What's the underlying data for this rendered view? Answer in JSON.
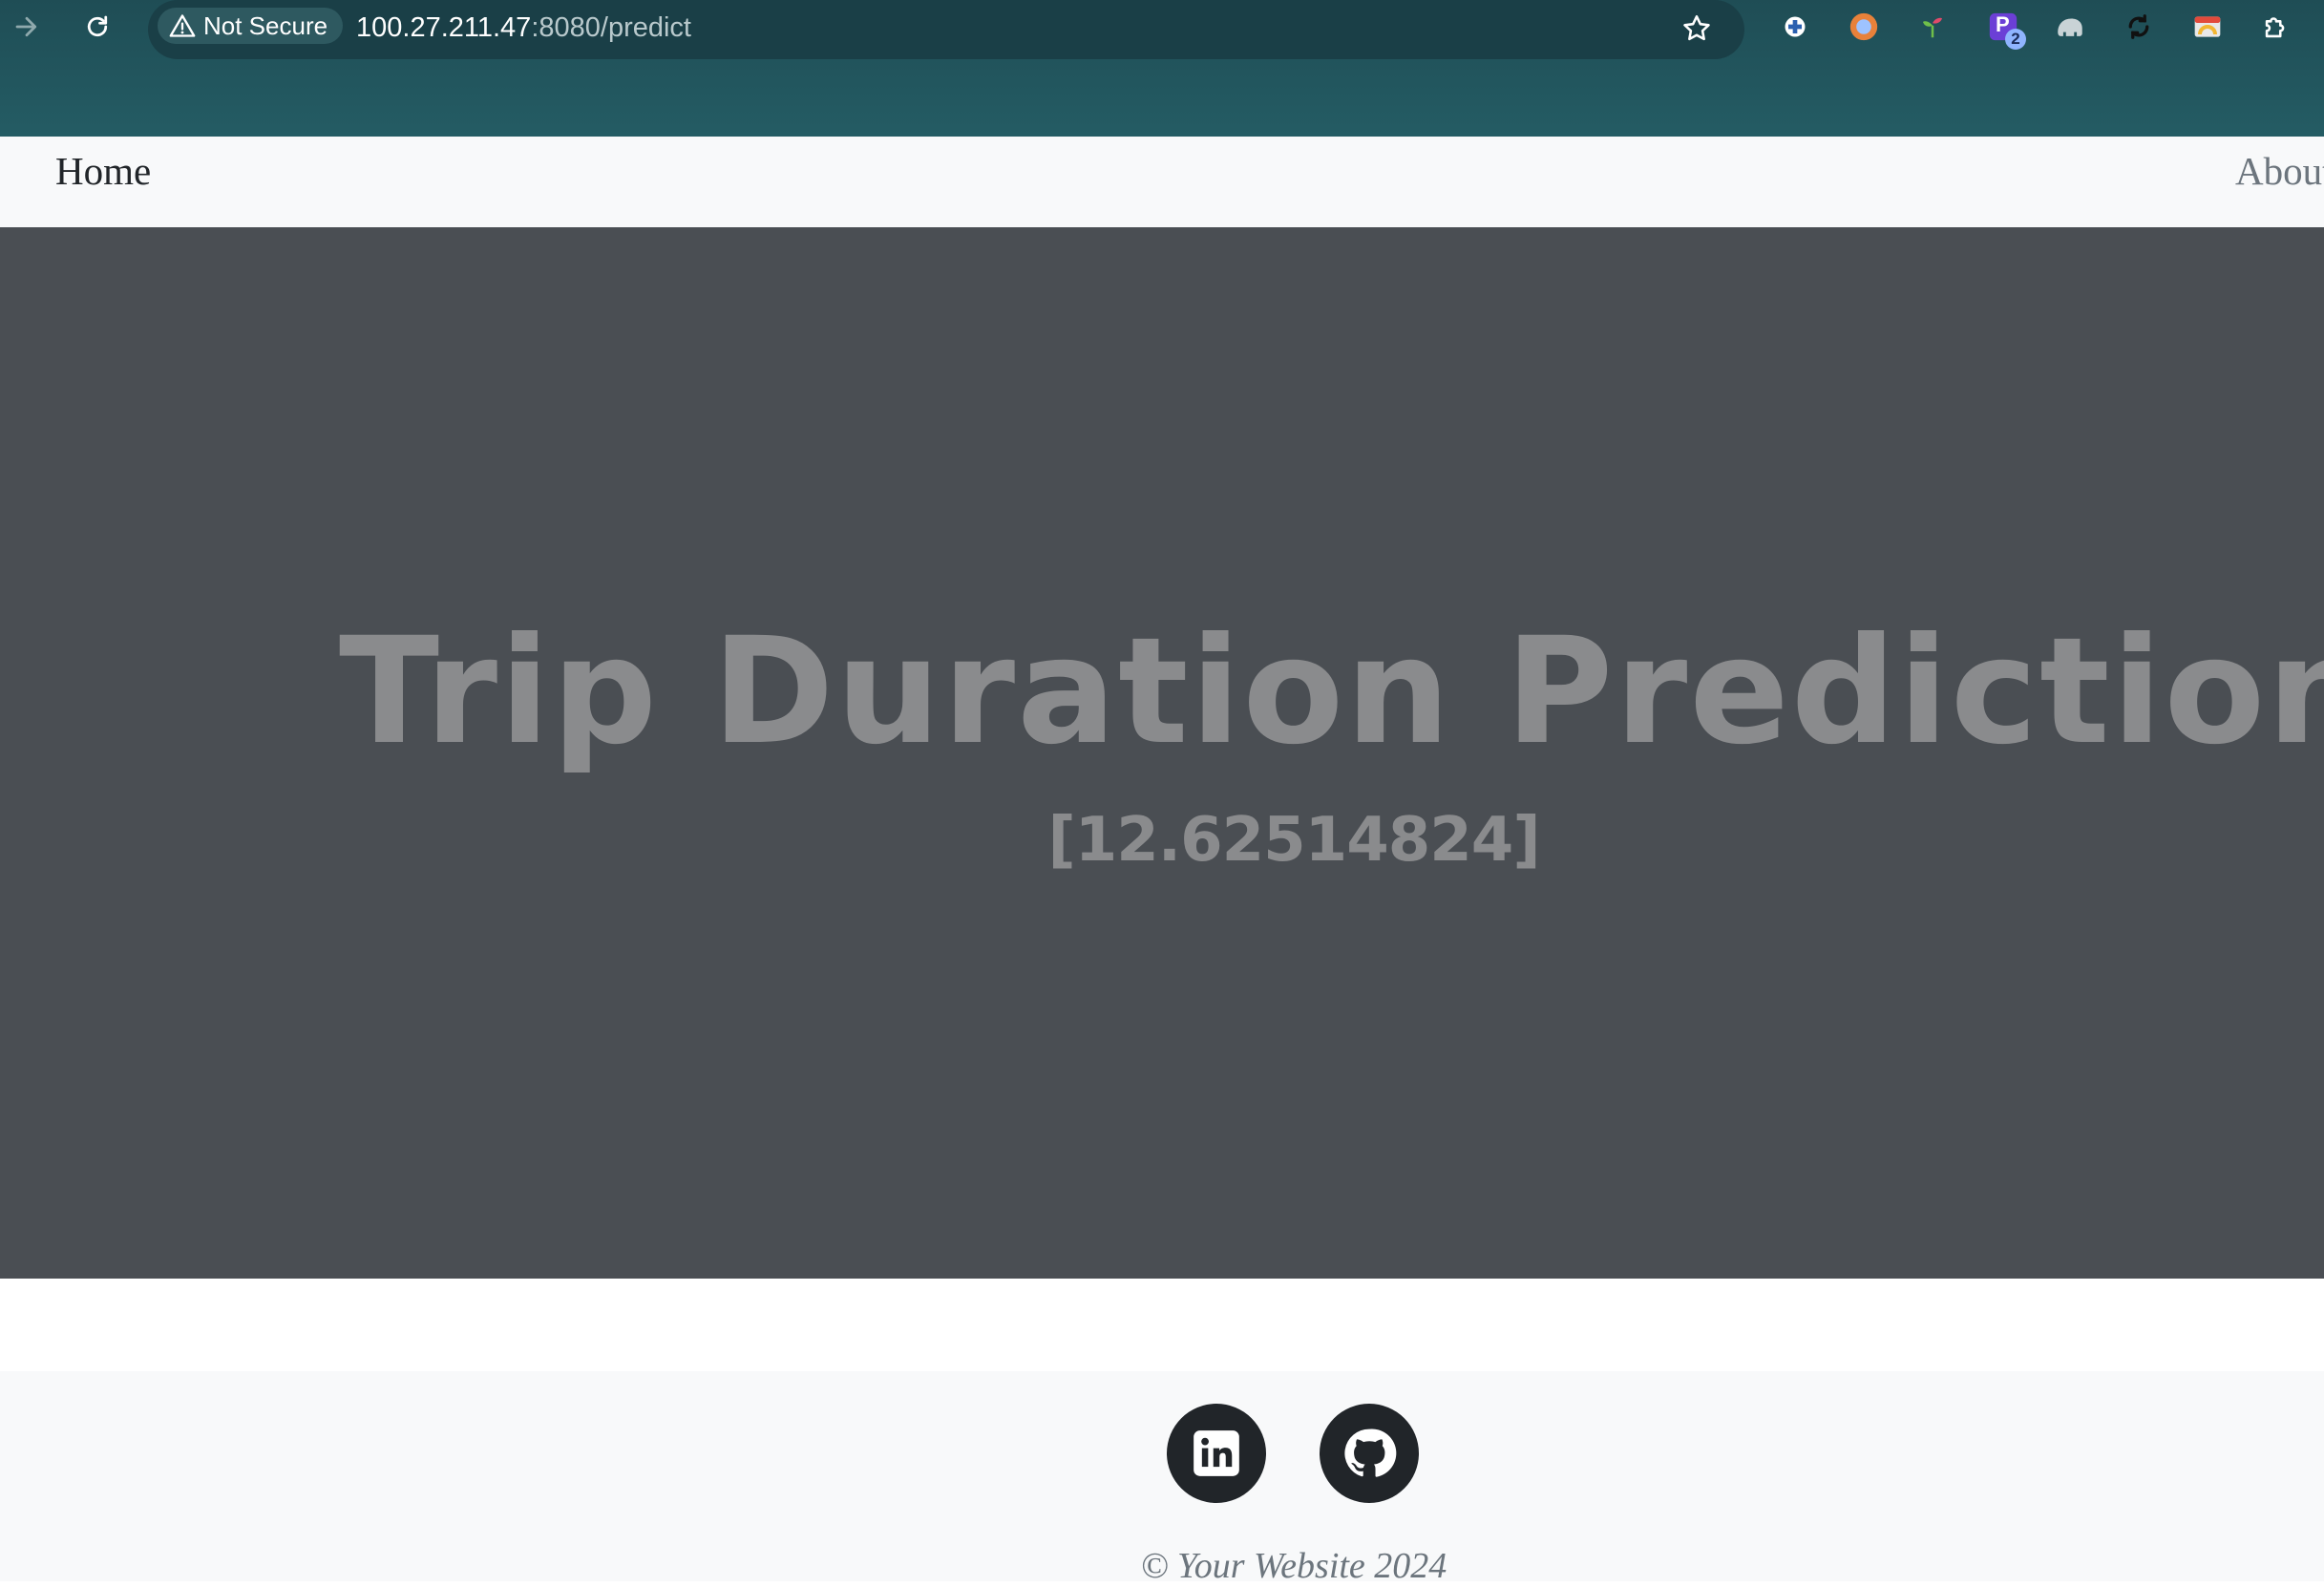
{
  "browser": {
    "security_label": "Not Secure",
    "url_host": "100.27.211.47",
    "url_rest": ":8080/predict",
    "extension_badge": "2",
    "extension_p_letter": "P"
  },
  "navbar": {
    "home_label": "Home",
    "about_label": "About"
  },
  "hero": {
    "title": "Trip Duration Prediction",
    "prediction": "[12.62514824]"
  },
  "footer": {
    "copyright": "© Your Website 2024",
    "social": [
      "linkedin-icon",
      "github-icon"
    ]
  },
  "colors": {
    "browser_bar": "#245c64",
    "hero_background": "#4a4e53",
    "hero_text": "#8a8b8d",
    "navbar_background": "#f8f9fa",
    "social_circle": "#212529"
  }
}
